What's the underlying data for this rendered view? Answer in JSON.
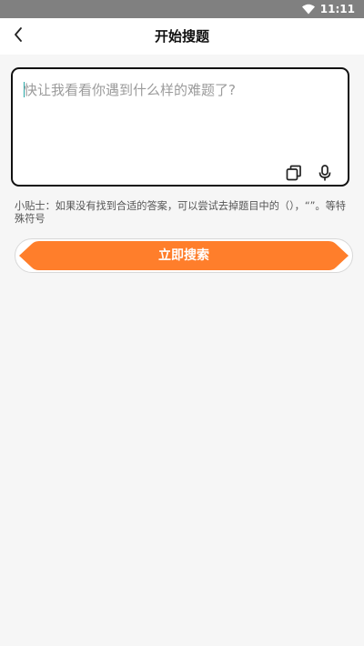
{
  "status_bar": {
    "time": "11:11",
    "icons": [
      "wifi-icon",
      "battery-icon"
    ]
  },
  "header": {
    "title": "开始搜题",
    "back_icon": "chevron-left-icon"
  },
  "search": {
    "placeholder": "快让我看看你遇到什么样的难题了?",
    "value": "",
    "tools": [
      "copy-icon",
      "microphone-icon"
    ]
  },
  "tip": {
    "text": "小贴士：如果没有找到合适的答案，可以尝试去掉题目中的（），“”。等特殊符号"
  },
  "actions": {
    "search_label": "立即搜索"
  },
  "colors": {
    "accent": "#FF7E2B",
    "status_bar": "#808080",
    "background": "#F6F6F6"
  }
}
